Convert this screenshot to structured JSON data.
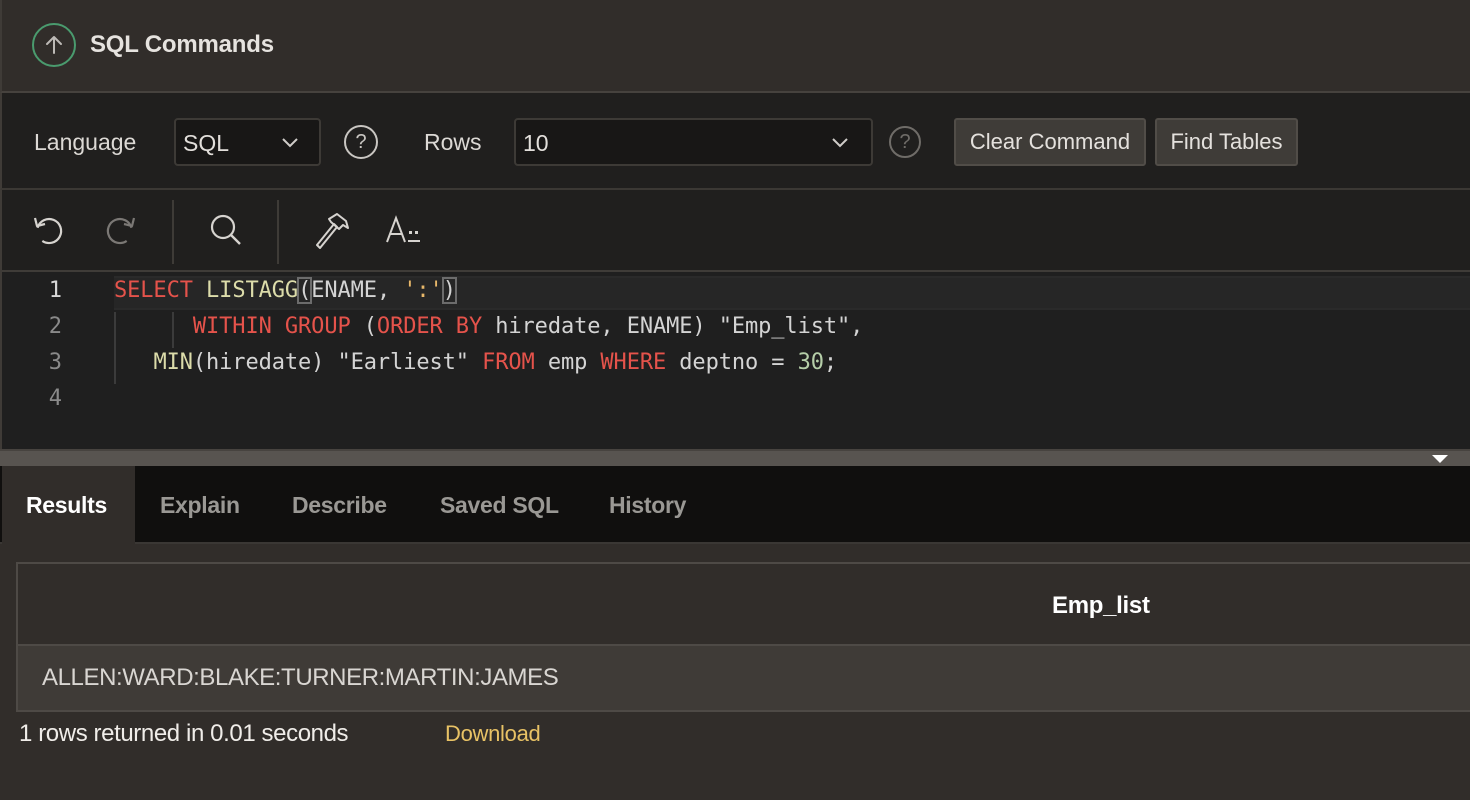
{
  "header": {
    "title": "SQL Commands",
    "collapse_icon": "arrow-up-circle-icon"
  },
  "toolbar": {
    "language_label": "Language",
    "language_value": "SQL",
    "rows_label": "Rows",
    "rows_value": "10",
    "help_icon": "question-circle-icon",
    "clear_command_label": "Clear Command",
    "find_tables_label": "Find Tables"
  },
  "editor_toolbar": {
    "icons": [
      "undo-icon",
      "redo-icon",
      "search-icon",
      "hammer-icon",
      "text-format-icon"
    ]
  },
  "editor": {
    "line_numbers": [
      "1",
      "2",
      "3",
      "4"
    ],
    "lines": [
      [
        {
          "t": "SELECT",
          "c": "kw"
        },
        {
          "t": " ",
          "c": ""
        },
        {
          "t": "LISTAGG",
          "c": "fn"
        },
        {
          "t": "(",
          "c": "bm"
        },
        {
          "t": "ENAME, ",
          "c": ""
        },
        {
          "t": "':'",
          "c": "str"
        },
        {
          "t": ")",
          "c": "bm"
        }
      ],
      [
        {
          "t": "      ",
          "c": ""
        },
        {
          "t": "WITHIN GROUP",
          "c": "kw"
        },
        {
          "t": " (",
          "c": ""
        },
        {
          "t": "ORDER BY",
          "c": "kw"
        },
        {
          "t": " hiredate, ENAME) \"Emp_list\",",
          "c": ""
        }
      ],
      [
        {
          "t": "   ",
          "c": ""
        },
        {
          "t": "MIN",
          "c": "fn"
        },
        {
          "t": "(hiredate) \"Earliest\" ",
          "c": ""
        },
        {
          "t": "FROM",
          "c": "kw"
        },
        {
          "t": " emp ",
          "c": ""
        },
        {
          "t": "WHERE",
          "c": "kw"
        },
        {
          "t": " deptno = ",
          "c": ""
        },
        {
          "t": "30",
          "c": "num"
        },
        {
          "t": ";",
          "c": ""
        }
      ],
      []
    ]
  },
  "tabs": [
    {
      "label": "Results",
      "active": true
    },
    {
      "label": "Explain",
      "active": false
    },
    {
      "label": "Describe",
      "active": false
    },
    {
      "label": "Saved SQL",
      "active": false
    },
    {
      "label": "History",
      "active": false
    }
  ],
  "results": {
    "columns": [
      "Emp_list"
    ],
    "rows": [
      [
        "ALLEN:WARD:BLAKE:TURNER:MARTIN:JAMES"
      ]
    ],
    "status": "1 rows returned in 0.01 seconds",
    "download_label": "Download"
  },
  "colors": {
    "accent_green": "#4a9b6e",
    "keyword": "#e5534b",
    "function": "#dcdcaa",
    "string": "#e8b86a",
    "number": "#b5cea8",
    "link": "#e8c265"
  }
}
